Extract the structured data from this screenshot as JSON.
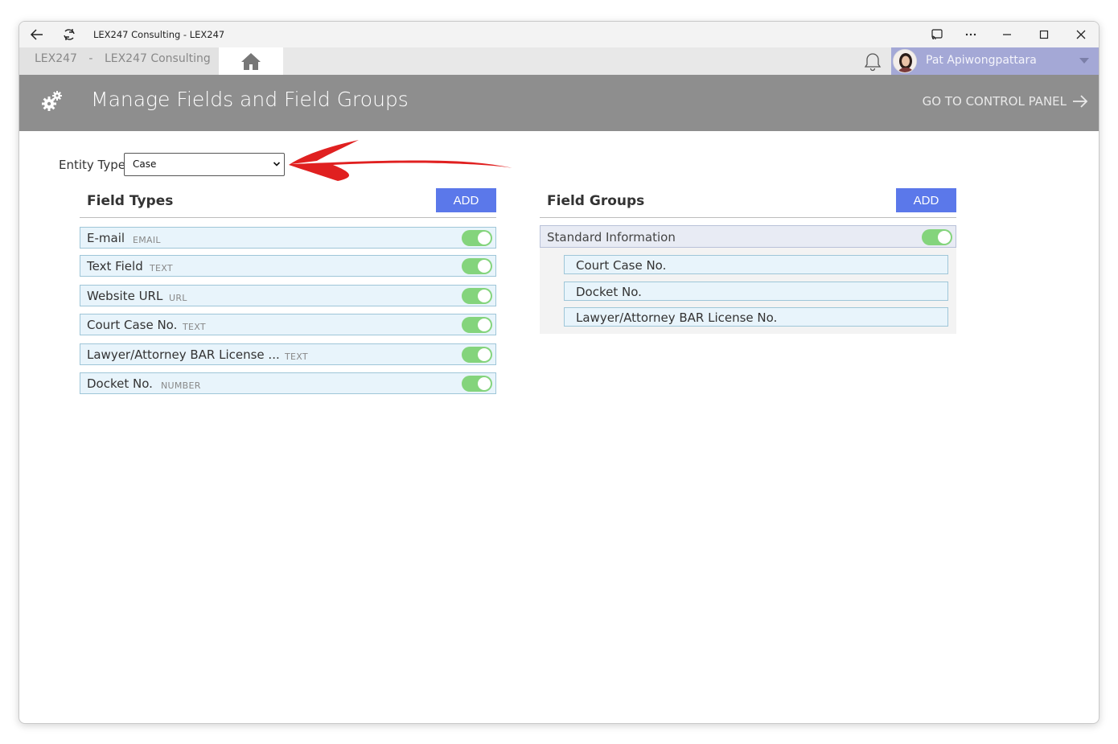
{
  "window": {
    "title": "LEX247 Consulting - LEX247"
  },
  "nav": {
    "crumb_app": "LEX247",
    "crumb_sep": "-",
    "crumb_org": "LEX247 Consulting",
    "user_name": "Pat Apiwongpattara"
  },
  "header": {
    "title": "Manage Fields and Field Groups",
    "goto_label": "GO TO CONTROL PANEL"
  },
  "entity": {
    "label": "Entity Type",
    "selected": "Case"
  },
  "field_types": {
    "title": "Field Types",
    "add_label": "ADD",
    "items": [
      {
        "name": "E-mail",
        "type": "EMAIL",
        "enabled": true
      },
      {
        "name": "Text Field",
        "type": "TEXT",
        "enabled": true
      },
      {
        "name": "Website URL",
        "type": "URL",
        "enabled": true
      },
      {
        "name": "Court Case No.",
        "type": "TEXT",
        "enabled": true
      },
      {
        "name": "Lawyer/Attorney BAR License ...",
        "type": "TEXT",
        "enabled": true
      },
      {
        "name": "Docket No.",
        "type": "NUMBER",
        "enabled": true
      }
    ]
  },
  "field_groups": {
    "title": "Field Groups",
    "add_label": "ADD",
    "groups": [
      {
        "name": "Standard Information",
        "enabled": true,
        "fields": [
          "Court Case No.",
          "Docket No.",
          "Lawyer/Attorney BAR License No."
        ]
      }
    ]
  },
  "colors": {
    "header_bg": "#8e8e8e",
    "accent_button": "#5b78ea",
    "toggle_on": "#84d47c",
    "user_box": "#a4a8d6",
    "annotation_arrow": "#e02020"
  }
}
